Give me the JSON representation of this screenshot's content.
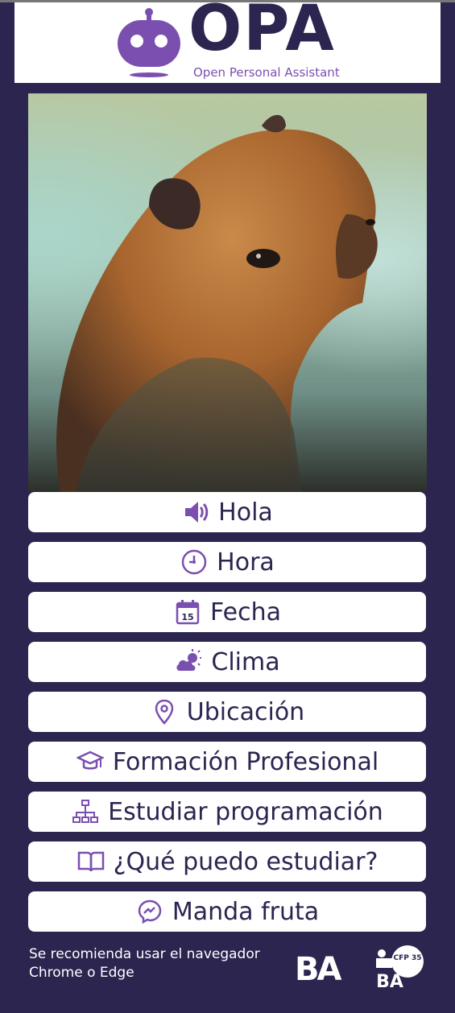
{
  "header": {
    "title": "OPA",
    "subtitle": "Open Personal Assistant"
  },
  "buttons": [
    {
      "label": "Hola",
      "icon": "volume-icon"
    },
    {
      "label": "Hora",
      "icon": "clock-icon"
    },
    {
      "label": "Fecha",
      "icon": "calendar-icon"
    },
    {
      "label": "Clima",
      "icon": "weather-icon"
    },
    {
      "label": "Ubicación",
      "icon": "location-pin-icon"
    },
    {
      "label": "Formación Profesional",
      "icon": "graduation-cap-icon"
    },
    {
      "label": "Estudiar programación",
      "icon": "sitemap-icon"
    },
    {
      "label": "¿Qué puedo estudiar?",
      "icon": "book-icon"
    },
    {
      "label": "Manda fruta",
      "icon": "messenger-icon"
    }
  ],
  "footer": {
    "line1": "Se recomienda usar el navegador",
    "line2": "Chrome o Edge",
    "ba_logo": "BA",
    "cfp_logo": "CFP 35",
    "cfp_badge": "BA"
  },
  "colors": {
    "background": "#2b2550",
    "accent": "#7b4fb0",
    "button_bg": "#ffffff"
  }
}
